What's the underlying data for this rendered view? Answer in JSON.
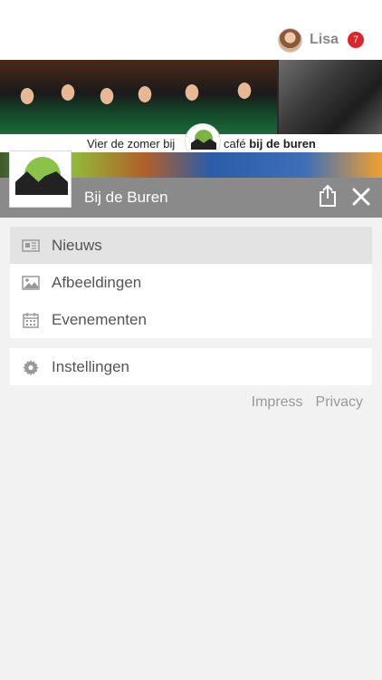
{
  "user": {
    "name": "Lisa",
    "notification_count": "7"
  },
  "banner": {
    "tagline": "Vier de zomer bij",
    "cafe_prefix": "café",
    "cafe_name": "bij de buren"
  },
  "header": {
    "title": "Bij de Buren"
  },
  "menu": {
    "items": [
      {
        "label": "Nieuws",
        "icon": "newspaper-icon",
        "active": true
      },
      {
        "label": "Afbeeldingen",
        "icon": "image-icon",
        "active": false
      },
      {
        "label": "Evenementen",
        "icon": "calendar-icon",
        "active": false
      }
    ],
    "settings": {
      "label": "Instellingen",
      "icon": "gear-icon"
    }
  },
  "footer": {
    "impress": "Impress",
    "privacy": "Privacy"
  },
  "colors": {
    "header_band": "#8a8a8a",
    "badge": "#e0242b",
    "active_item": "#e3e3e3",
    "background": "#f2f2f2"
  }
}
